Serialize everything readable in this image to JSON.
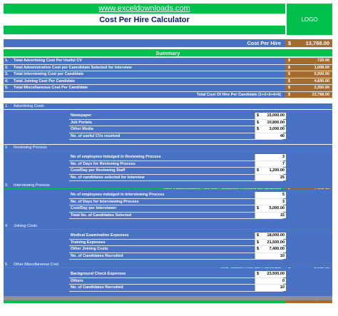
{
  "header": {
    "website": "www.exceldownloads.com",
    "title": "Cost Per Hire Calculator",
    "logo": "LOGO"
  },
  "cost_per_hire": {
    "label": "Cost Per Hire",
    "currency": "$",
    "value": "13,768.00"
  },
  "summary": {
    "heading": "Summary",
    "rows": [
      {
        "num": "1.",
        "label": "Total Advertising Cost Per Useful CV",
        "currency": "$",
        "value": "720.00"
      },
      {
        "num": "2.",
        "label": "Total Administrative Cost per Cancdidate Selected for Interview",
        "currency": "$",
        "value": "1,008.00"
      },
      {
        "num": "3.",
        "label": "Total Interviewing Cost per Candidate",
        "currency": "$",
        "value": "5,000.00"
      },
      {
        "num": "4.",
        "label": "Total Joining Cost Per Candidate",
        "currency": "$",
        "value": "4,690.00"
      },
      {
        "num": "5.",
        "label": "Total Miscellaneous Cost Per Candidate",
        "currency": "$",
        "value": "2,350.00"
      }
    ],
    "total_label": "Total Cost Of Hire Per Candidate (1+2+3+4+5)",
    "total_currency": "$",
    "total_value": "13,768.00"
  },
  "sections": [
    {
      "num": "1.",
      "title": "Advertising Costs",
      "items": [
        {
          "label": "Newspaper",
          "currency": "$",
          "value": "15,000.00"
        },
        {
          "label": "Job Portals",
          "currency": "$",
          "value": "10,800.00"
        },
        {
          "label": "Other Media",
          "currency": "$",
          "value": "3,000.00"
        },
        {
          "label": "No. of useful CVs received",
          "currency": "",
          "value": "40"
        }
      ],
      "total_label": "Total Advertising Cost Per Useful CV",
      "total_currency": "$",
      "total_value": "720.00"
    },
    {
      "num": "2.",
      "title": "Reviewing Process",
      "items": [
        {
          "label": "No of employees indulged in Reviewing Process",
          "currency": "",
          "value": "3"
        },
        {
          "label": "No. of Days for Reviewing Process",
          "currency": "",
          "value": "7"
        },
        {
          "label": "Cost/Day per Reviewing Staff",
          "currency": "$",
          "value": "1,200.00"
        },
        {
          "label": "No. of candidates selected for Interview",
          "currency": "",
          "value": "25"
        }
      ],
      "total_label": "Total Administrative Cost per Cancdidate Selected for Interview",
      "total_currency": "$",
      "total_value": "1,008.00"
    },
    {
      "num": "3.",
      "title": "Interviewing Process",
      "items": [
        {
          "label": "No of employees indulged in Interviewing Process",
          "currency": "",
          "value": "5"
        },
        {
          "label": "No. of Days for Interviewing Process",
          "currency": "",
          "value": "3"
        },
        {
          "label": "Cost/Day per Interviewer",
          "currency": "$",
          "value": "5,000.00"
        },
        {
          "label": "Total No. of Candidates Selected",
          "currency": "",
          "value": "15"
        }
      ],
      "total_label": "Total Interviewing Cost per Candidate",
      "total_currency": "$",
      "total_value": "5,000.00"
    },
    {
      "num": "4.",
      "title": "Joining Costs",
      "items": [
        {
          "label": "Medical Examination Expenses",
          "currency": "$",
          "value": "18,000.00"
        },
        {
          "label": "Training Expenses",
          "currency": "$",
          "value": "21,500.00"
        },
        {
          "label": "Other Joining Costs",
          "currency": "$",
          "value": "7,400.00"
        },
        {
          "label": "No. of Candidates Recruited",
          "currency": "",
          "value": "10"
        }
      ],
      "total_label": "Total Joining Cost Per Candidate",
      "total_currency": "$",
      "total_value": "4,690.00"
    },
    {
      "num": "5.",
      "title": "Other Miscellaneous Cost",
      "items": [
        {
          "label": "Background Check Expenses",
          "currency": "$",
          "value": "23,500.00"
        },
        {
          "label": "Others",
          "currency": "",
          "value": "0"
        },
        {
          "label": "No. of Candidates Recruited",
          "currency": "",
          "value": "10"
        }
      ],
      "total_label": "Total Miscellaneous Cost Per Candidate",
      "total_currency": "$",
      "total_value": "2,350.00"
    }
  ],
  "colors": {
    "green": "#00c04d",
    "blue": "#4a72c4",
    "brown": "#a46b2f"
  }
}
